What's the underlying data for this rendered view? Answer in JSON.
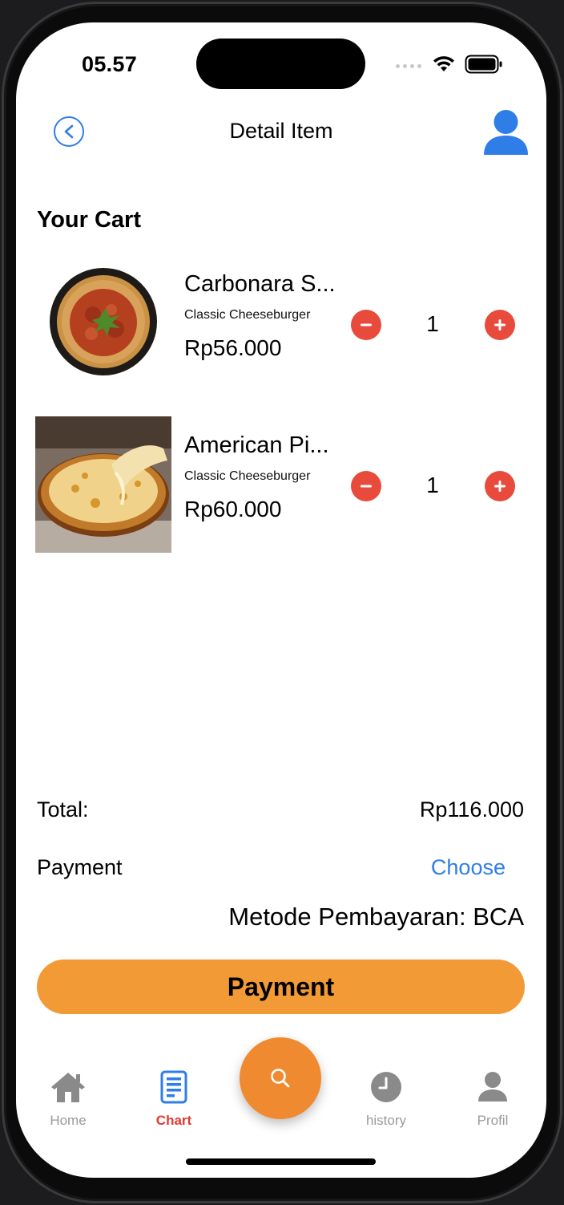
{
  "status_bar": {
    "time": "05.57"
  },
  "header": {
    "title": "Detail Item"
  },
  "cart": {
    "title": "Your Cart",
    "items": [
      {
        "name": "Carbonara S...",
        "description": "Classic Cheeseburger",
        "price": "Rp56.000",
        "quantity": "1",
        "image": "spaghetti-image"
      },
      {
        "name": "American Pi...",
        "description": "Classic Cheeseburger",
        "price": "Rp60.000",
        "quantity": "1",
        "image": "pizza-image"
      }
    ]
  },
  "summary": {
    "total_label": "Total:",
    "total_value": "Rp116.000",
    "payment_label": "Payment",
    "choose_label": "Choose",
    "method_text": "Metode Pembayaran: BCA"
  },
  "pay_button": {
    "label": "Payment"
  },
  "tabbar": {
    "items": [
      {
        "label": "Home",
        "icon": "home-icon"
      },
      {
        "label": "Chart",
        "icon": "chart-icon"
      },
      {
        "label": "history",
        "icon": "clock-icon"
      },
      {
        "label": "Profil",
        "icon": "person-icon"
      }
    ],
    "center_icon": "search-icon"
  },
  "colors": {
    "accent_blue": "#2f7ee8",
    "qty_red": "#e84a3c",
    "pay_orange": "#f29a35",
    "fab_orange": "#f08a30",
    "active_tab": "#e03a2f"
  }
}
